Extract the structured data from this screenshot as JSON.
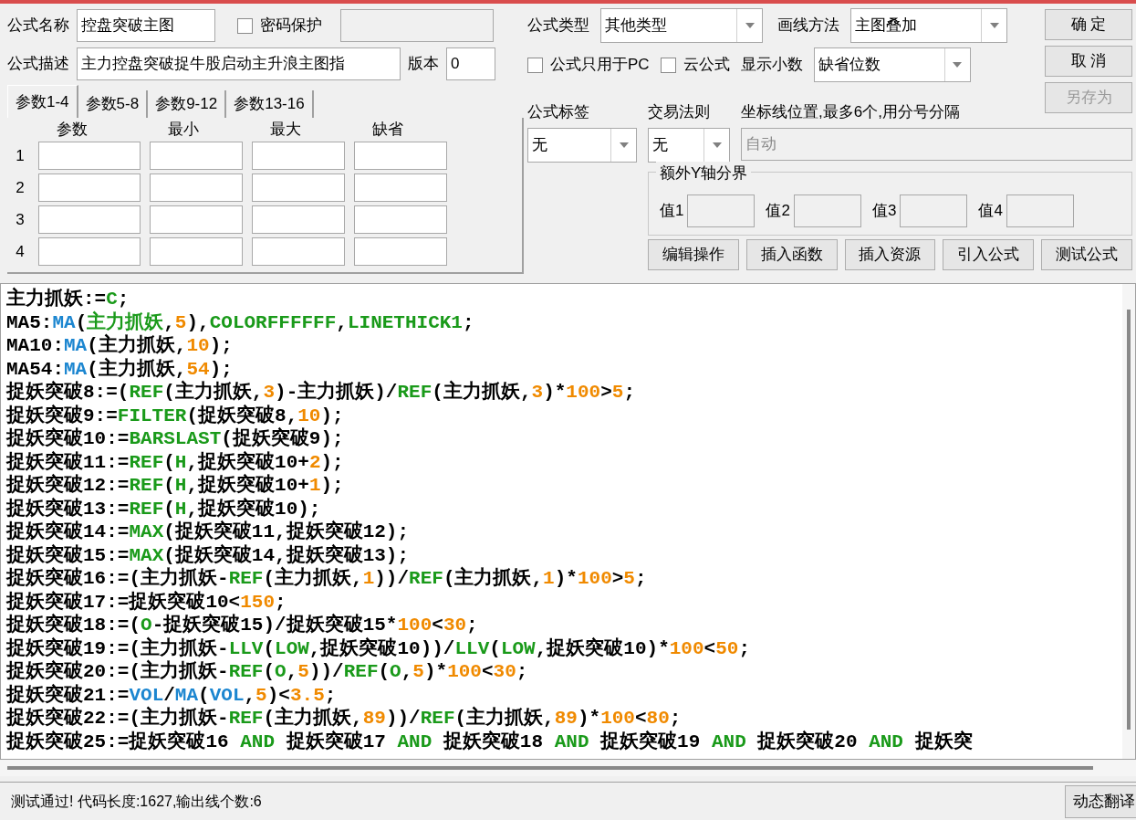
{
  "form": {
    "name": {
      "label": "公式名称",
      "value": "控盘突破主图"
    },
    "password": {
      "label": "密码保护",
      "checked": false
    },
    "description": {
      "label": "公式描述",
      "value": "主力控盘突破捉牛股启动主升浪主图指"
    },
    "version": {
      "label": "版本",
      "value": "0"
    },
    "formula_type": {
      "label": "公式类型",
      "value": "其他类型"
    },
    "draw_method": {
      "label": "画线方法",
      "value": "主图叠加"
    },
    "pc_only": {
      "label": "公式只用于PC",
      "checked": false
    },
    "cloud": {
      "label": "云公式",
      "checked": false
    },
    "decimals": {
      "label": "显示小数",
      "value": "缺省位数"
    },
    "tag": {
      "label": "公式标签",
      "value": "无"
    },
    "trade_rule": {
      "label": "交易法则",
      "value": "无"
    },
    "axis_lines": {
      "label": "坐标线位置,最多6个,用分号分隔",
      "value": "自动",
      "disabled": true
    },
    "extra_y": {
      "title": "额外Y轴分界",
      "fields": [
        "值1",
        "值2",
        "值3",
        "值4"
      ]
    }
  },
  "buttons": [
    {
      "label": "确 定",
      "disabled": false
    },
    {
      "label": "取 消",
      "disabled": false
    },
    {
      "label": "另存为",
      "disabled": true
    }
  ],
  "tool_buttons": [
    "编辑操作",
    "插入函数",
    "插入资源",
    "引入公式",
    "测试公式"
  ],
  "param_tabs": [
    {
      "label": "参数1-4",
      "selected": true
    },
    {
      "label": "参数5-8",
      "selected": false
    },
    {
      "label": "参数9-12",
      "selected": false
    },
    {
      "label": "参数13-16",
      "selected": false
    }
  ],
  "param_columns": [
    "参数",
    "最小",
    "最大",
    "缺省"
  ],
  "param_rows": [
    "1",
    "2",
    "3",
    "4"
  ],
  "code_lines": [
    [
      {
        "kind": "plain",
        "text": "主力抓妖:="
      },
      {
        "kind": "keyword",
        "text": "C"
      },
      {
        "kind": "plain",
        "text": ";"
      }
    ],
    [
      {
        "kind": "plain",
        "text": "MA5:"
      },
      {
        "kind": "builtin",
        "text": "MA"
      },
      {
        "kind": "plain",
        "text": "("
      },
      {
        "kind": "keyword",
        "text": "主力抓妖"
      },
      {
        "kind": "plain",
        "text": ","
      },
      {
        "kind": "number",
        "text": "5"
      },
      {
        "kind": "plain",
        "text": "),"
      },
      {
        "kind": "keyword",
        "text": "COLORFFFFFF"
      },
      {
        "kind": "plain",
        "text": ","
      },
      {
        "kind": "keyword",
        "text": "LINETHICK1"
      },
      {
        "kind": "plain",
        "text": ";"
      }
    ],
    [
      {
        "kind": "plain",
        "text": "MA10:"
      },
      {
        "kind": "builtin",
        "text": "MA"
      },
      {
        "kind": "plain",
        "text": "(主力抓妖,"
      },
      {
        "kind": "number",
        "text": "10"
      },
      {
        "kind": "plain",
        "text": ");"
      }
    ],
    [
      {
        "kind": "plain",
        "text": "MA54:"
      },
      {
        "kind": "builtin",
        "text": "MA"
      },
      {
        "kind": "plain",
        "text": "(主力抓妖,"
      },
      {
        "kind": "number",
        "text": "54"
      },
      {
        "kind": "plain",
        "text": ");"
      }
    ],
    [
      {
        "kind": "plain",
        "text": "捉妖突破8:=("
      },
      {
        "kind": "keyword",
        "text": "REF"
      },
      {
        "kind": "plain",
        "text": "(主力抓妖,"
      },
      {
        "kind": "number",
        "text": "3"
      },
      {
        "kind": "plain",
        "text": ")-主力抓妖)/"
      },
      {
        "kind": "keyword",
        "text": "REF"
      },
      {
        "kind": "plain",
        "text": "(主力抓妖,"
      },
      {
        "kind": "number",
        "text": "3"
      },
      {
        "kind": "plain",
        "text": ")*"
      },
      {
        "kind": "number",
        "text": "100"
      },
      {
        "kind": "plain",
        "text": ">"
      },
      {
        "kind": "number",
        "text": "5"
      },
      {
        "kind": "plain",
        "text": ";"
      }
    ],
    [
      {
        "kind": "plain",
        "text": "捉妖突破9:="
      },
      {
        "kind": "keyword",
        "text": "FILTER"
      },
      {
        "kind": "plain",
        "text": "(捉妖突破8,"
      },
      {
        "kind": "number",
        "text": "10"
      },
      {
        "kind": "plain",
        "text": ");"
      }
    ],
    [
      {
        "kind": "plain",
        "text": "捉妖突破10:="
      },
      {
        "kind": "keyword",
        "text": "BARSLAST"
      },
      {
        "kind": "plain",
        "text": "(捉妖突破9);"
      }
    ],
    [
      {
        "kind": "plain",
        "text": "捉妖突破11:="
      },
      {
        "kind": "keyword",
        "text": "REF"
      },
      {
        "kind": "plain",
        "text": "("
      },
      {
        "kind": "keyword",
        "text": "H"
      },
      {
        "kind": "plain",
        "text": ",捉妖突破10+"
      },
      {
        "kind": "number",
        "text": "2"
      },
      {
        "kind": "plain",
        "text": ");"
      }
    ],
    [
      {
        "kind": "plain",
        "text": "捉妖突破12:="
      },
      {
        "kind": "keyword",
        "text": "REF"
      },
      {
        "kind": "plain",
        "text": "("
      },
      {
        "kind": "keyword",
        "text": "H"
      },
      {
        "kind": "plain",
        "text": ",捉妖突破10+"
      },
      {
        "kind": "number",
        "text": "1"
      },
      {
        "kind": "plain",
        "text": ");"
      }
    ],
    [
      {
        "kind": "plain",
        "text": "捉妖突破13:="
      },
      {
        "kind": "keyword",
        "text": "REF"
      },
      {
        "kind": "plain",
        "text": "("
      },
      {
        "kind": "keyword",
        "text": "H"
      },
      {
        "kind": "plain",
        "text": ",捉妖突破10);"
      }
    ],
    [
      {
        "kind": "plain",
        "text": "捉妖突破14:="
      },
      {
        "kind": "keyword",
        "text": "MAX"
      },
      {
        "kind": "plain",
        "text": "(捉妖突破11,捉妖突破12);"
      }
    ],
    [
      {
        "kind": "plain",
        "text": "捉妖突破15:="
      },
      {
        "kind": "keyword",
        "text": "MAX"
      },
      {
        "kind": "plain",
        "text": "(捉妖突破14,捉妖突破13);"
      }
    ],
    [
      {
        "kind": "plain",
        "text": "捉妖突破16:=(主力抓妖-"
      },
      {
        "kind": "keyword",
        "text": "REF"
      },
      {
        "kind": "plain",
        "text": "(主力抓妖,"
      },
      {
        "kind": "number",
        "text": "1"
      },
      {
        "kind": "plain",
        "text": "))/"
      },
      {
        "kind": "keyword",
        "text": "REF"
      },
      {
        "kind": "plain",
        "text": "(主力抓妖,"
      },
      {
        "kind": "number",
        "text": "1"
      },
      {
        "kind": "plain",
        "text": ")*"
      },
      {
        "kind": "number",
        "text": "100"
      },
      {
        "kind": "plain",
        "text": ">"
      },
      {
        "kind": "number",
        "text": "5"
      },
      {
        "kind": "plain",
        "text": ";"
      }
    ],
    [
      {
        "kind": "plain",
        "text": "捉妖突破17:=捉妖突破10<"
      },
      {
        "kind": "number",
        "text": "150"
      },
      {
        "kind": "plain",
        "text": ";"
      }
    ],
    [
      {
        "kind": "plain",
        "text": "捉妖突破18:=("
      },
      {
        "kind": "keyword",
        "text": "O"
      },
      {
        "kind": "plain",
        "text": "-捉妖突破15)/捉妖突破15*"
      },
      {
        "kind": "number",
        "text": "100"
      },
      {
        "kind": "plain",
        "text": "<"
      },
      {
        "kind": "number",
        "text": "30"
      },
      {
        "kind": "plain",
        "text": ";"
      }
    ],
    [
      {
        "kind": "plain",
        "text": "捉妖突破19:=(主力抓妖-"
      },
      {
        "kind": "keyword",
        "text": "LLV"
      },
      {
        "kind": "plain",
        "text": "("
      },
      {
        "kind": "keyword",
        "text": "LOW"
      },
      {
        "kind": "plain",
        "text": ",捉妖突破10))/"
      },
      {
        "kind": "keyword",
        "text": "LLV"
      },
      {
        "kind": "plain",
        "text": "("
      },
      {
        "kind": "keyword",
        "text": "LOW"
      },
      {
        "kind": "plain",
        "text": ",捉妖突破10)*"
      },
      {
        "kind": "number",
        "text": "100"
      },
      {
        "kind": "plain",
        "text": "<"
      },
      {
        "kind": "number",
        "text": "50"
      },
      {
        "kind": "plain",
        "text": ";"
      }
    ],
    [
      {
        "kind": "plain",
        "text": "捉妖突破20:=(主力抓妖-"
      },
      {
        "kind": "keyword",
        "text": "REF"
      },
      {
        "kind": "plain",
        "text": "("
      },
      {
        "kind": "keyword",
        "text": "O"
      },
      {
        "kind": "plain",
        "text": ","
      },
      {
        "kind": "number",
        "text": "5"
      },
      {
        "kind": "plain",
        "text": "))/"
      },
      {
        "kind": "keyword",
        "text": "REF"
      },
      {
        "kind": "plain",
        "text": "("
      },
      {
        "kind": "keyword",
        "text": "O"
      },
      {
        "kind": "plain",
        "text": ","
      },
      {
        "kind": "number",
        "text": "5"
      },
      {
        "kind": "plain",
        "text": ")*"
      },
      {
        "kind": "number",
        "text": "100"
      },
      {
        "kind": "plain",
        "text": "<"
      },
      {
        "kind": "number",
        "text": "30"
      },
      {
        "kind": "plain",
        "text": ";"
      }
    ],
    [
      {
        "kind": "plain",
        "text": "捉妖突破21:="
      },
      {
        "kind": "builtin",
        "text": "VOL"
      },
      {
        "kind": "plain",
        "text": "/"
      },
      {
        "kind": "builtin",
        "text": "MA"
      },
      {
        "kind": "plain",
        "text": "("
      },
      {
        "kind": "builtin",
        "text": "VOL"
      },
      {
        "kind": "plain",
        "text": ","
      },
      {
        "kind": "number",
        "text": "5"
      },
      {
        "kind": "plain",
        "text": ")<"
      },
      {
        "kind": "number",
        "text": "3.5"
      },
      {
        "kind": "plain",
        "text": ";"
      }
    ],
    [
      {
        "kind": "plain",
        "text": "捉妖突破22:=(主力抓妖-"
      },
      {
        "kind": "keyword",
        "text": "REF"
      },
      {
        "kind": "plain",
        "text": "(主力抓妖,"
      },
      {
        "kind": "number",
        "text": "89"
      },
      {
        "kind": "plain",
        "text": "))/"
      },
      {
        "kind": "keyword",
        "text": "REF"
      },
      {
        "kind": "plain",
        "text": "(主力抓妖,"
      },
      {
        "kind": "number",
        "text": "89"
      },
      {
        "kind": "plain",
        "text": ")*"
      },
      {
        "kind": "number",
        "text": "100"
      },
      {
        "kind": "plain",
        "text": "<"
      },
      {
        "kind": "number",
        "text": "80"
      },
      {
        "kind": "plain",
        "text": ";"
      }
    ],
    [
      {
        "kind": "plain",
        "text": "捉妖突破25:=捉妖突破16 "
      },
      {
        "kind": "keyword",
        "text": "AND"
      },
      {
        "kind": "plain",
        "text": " 捉妖突破17 "
      },
      {
        "kind": "keyword",
        "text": "AND"
      },
      {
        "kind": "plain",
        "text": " 捉妖突破18 "
      },
      {
        "kind": "keyword",
        "text": "AND"
      },
      {
        "kind": "plain",
        "text": " 捉妖突破19 "
      },
      {
        "kind": "keyword",
        "text": "AND"
      },
      {
        "kind": "plain",
        "text": " 捉妖突破20 "
      },
      {
        "kind": "keyword",
        "text": "AND"
      },
      {
        "kind": "plain",
        "text": " 捉妖突"
      }
    ]
  ],
  "status": "测试通过! 代码长度:1627,输出线个数:6",
  "translate_button": "动态翻译"
}
